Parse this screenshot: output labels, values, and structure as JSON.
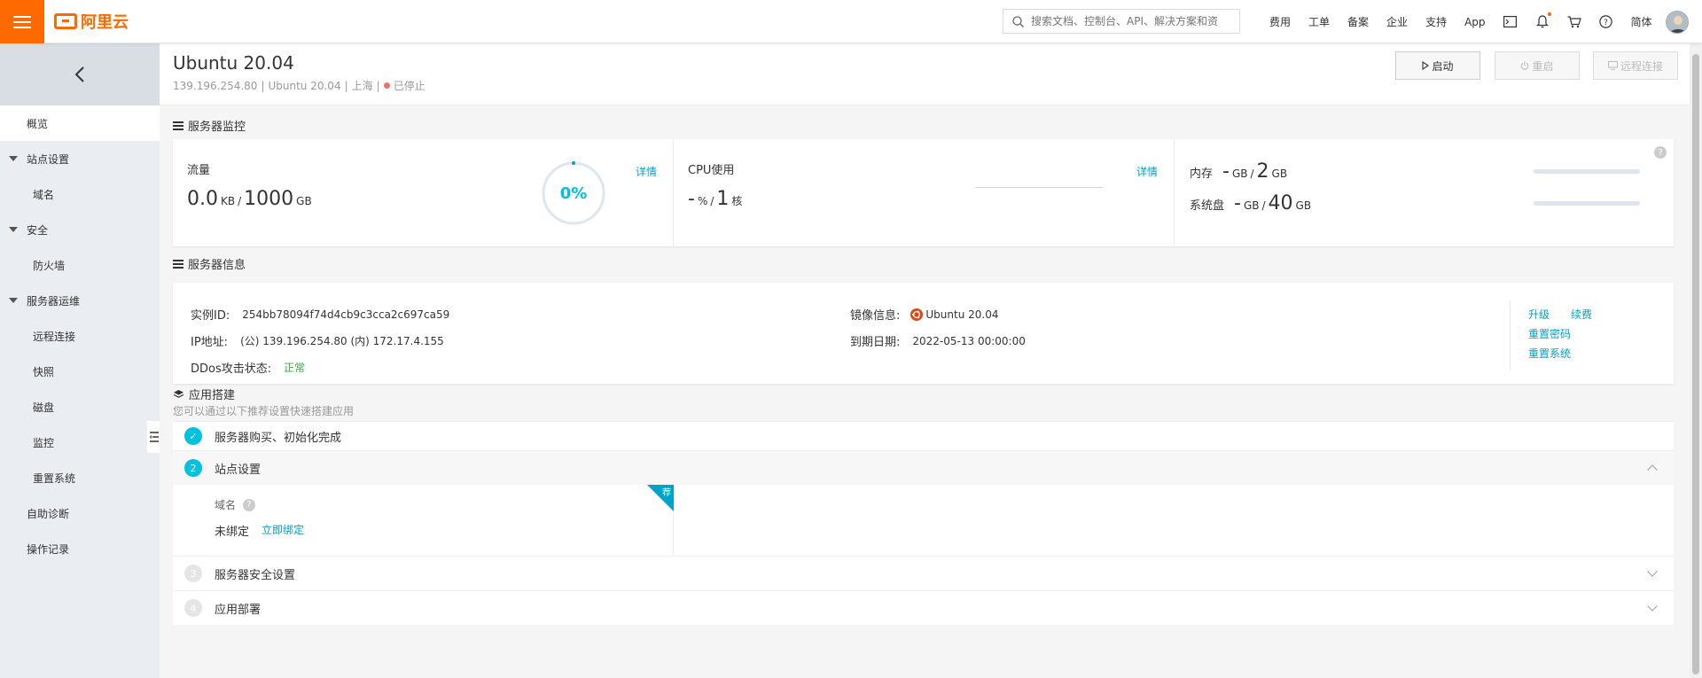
{
  "topbar": {
    "logo_text": "阿里云",
    "search_placeholder": "搜索文档、控制台、API、解决方案和资",
    "nav": [
      "费用",
      "工单",
      "备案",
      "企业",
      "支持",
      "App"
    ],
    "lang": "简体"
  },
  "sidebar": {
    "items": [
      {
        "label": "概览"
      },
      {
        "label": "站点设置"
      },
      {
        "label": "域名"
      },
      {
        "label": "安全"
      },
      {
        "label": "防火墙"
      },
      {
        "label": "服务器运维"
      },
      {
        "label": "远程连接"
      },
      {
        "label": "快照"
      },
      {
        "label": "磁盘"
      },
      {
        "label": "监控"
      },
      {
        "label": "重置系统"
      },
      {
        "label": "自助诊断"
      },
      {
        "label": "操作记录"
      }
    ]
  },
  "header": {
    "title": "Ubuntu 20.04",
    "ip": "139.196.254.80",
    "os": "Ubuntu 20.04",
    "region": "上海",
    "sep": "|",
    "status": "已停止",
    "btn_start": "启动",
    "btn_restart": "重启",
    "btn_remote": "远程连接"
  },
  "monitor": {
    "title": "服务器监控",
    "traffic_label": "流量",
    "traffic_used": "0.0",
    "traffic_used_unit": "KB",
    "slash": "/",
    "traffic_total": "1000",
    "traffic_total_unit": "GB",
    "traffic_percent": "0%",
    "detail": "详情",
    "cpu_label": "CPU使用",
    "cpu_value": "-",
    "cpu_unit": "%",
    "cpu_cores": "1",
    "cpu_cores_unit": "核",
    "mem_label": "内存",
    "mem_used": "-",
    "mem_used_unit": "GB",
    "mem_total": "2",
    "mem_total_unit": "GB",
    "disk_label": "系统盘",
    "disk_used": "-",
    "disk_used_unit": "GB",
    "disk_total": "40",
    "disk_total_unit": "GB",
    "help": "?"
  },
  "info": {
    "title": "服务器信息",
    "instance_label": "实例ID:",
    "instance_id": "254bb78094f74d4cb9c3cca2c697ca59",
    "ip_label": "IP地址:",
    "ip_value": "(公) 139.196.254.80 (内) 172.17.4.155",
    "ddos_label": "DDos攻击状态:",
    "ddos_value": "正常",
    "image_label": "镜像信息:",
    "image_value": "Ubuntu 20.04",
    "expire_label": "到期日期:",
    "expire_value": "2022-05-13 00:00:00",
    "actions": {
      "upgrade": "升级",
      "renew": "续费",
      "reset_pwd": "重置密码",
      "reset_sys": "重置系统"
    }
  },
  "app": {
    "title": "应用搭建",
    "subtitle": "您可以通过以下推荐设置快速搭建应用",
    "steps": [
      {
        "num": "✓",
        "label": "服务器购买、初始化完成"
      },
      {
        "num": "2",
        "label": "站点设置"
      },
      {
        "num": "3",
        "label": "服务器安全设置"
      },
      {
        "num": "4",
        "label": "应用部署"
      }
    ],
    "domain_label": "域名",
    "domain_status": "未绑定",
    "bind_now": "立即绑定",
    "ribbon": "荐",
    "help": "?"
  }
}
